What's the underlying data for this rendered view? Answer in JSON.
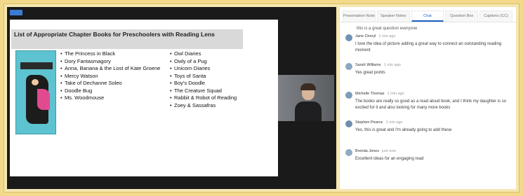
{
  "slide": {
    "title": "List of Appropriate Chapter Books for Preschoolers with Reading Lens",
    "cover": {
      "title": "",
      "band": ""
    },
    "books_col1": [
      "The Princess in Black",
      "Dory Fantasmagory",
      "Anna, Banana & the Lost of Kate Groene",
      "Mercy Watson",
      "Take of Dechanne Soleo",
      "Doodle Bug",
      "Ms. Woodmouse"
    ],
    "books_col2": [
      "Owl Diaries",
      "Owly of a Pug",
      "Unicorn Diaries",
      "Toys of Santa",
      "Boy's Doodle",
      "The Creature Squad",
      "Rabbit & Robot of Reading",
      "Zoey & Sassafras"
    ]
  },
  "sidebar": {
    "tabs": [
      {
        "label": "Presentation Notes",
        "active": false
      },
      {
        "label": "Speaker Notes",
        "active": false
      },
      {
        "label": "Chat",
        "active": true
      },
      {
        "label": "Question Box",
        "active": false
      },
      {
        "label": "Captions (CC)",
        "active": false
      }
    ],
    "chat_top": "this is a great question everyone",
    "messages": [
      {
        "name": "Jane Cheryl",
        "time": "1 min ago",
        "text": "I love the idea of picture adding a great way to connect an outstanding reading moment",
        "avatar_color": "#6f93b3"
      },
      {
        "name": "Sarah Williams",
        "time": "1 min ago",
        "text": "Yes great points",
        "avatar_color": "#8aa7c0"
      },
      {
        "name": "Michelle Thomas",
        "time": "1 min ago",
        "text": "The books are really so good as a read aloud book, and I think my daughter is so excited for it and also looking for many more books",
        "avatar_color": "#7d9cb8"
      },
      {
        "name": "Stephen Pearce",
        "time": "1 min ago",
        "text": "Yes, this is great and I'm already going to add these",
        "avatar_color": "#6e8fae"
      },
      {
        "name": "Brenda Jones",
        "time": "just now",
        "text": "Excellent ideas for an engaging read",
        "avatar_color": "#92abc2"
      }
    ]
  }
}
